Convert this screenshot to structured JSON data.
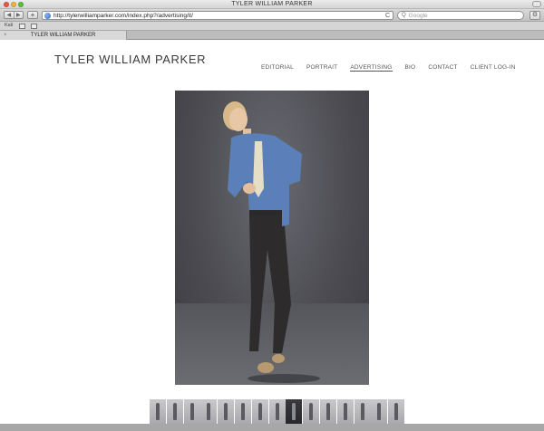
{
  "window": {
    "title": "TYLER WILLIAM PARKER"
  },
  "toolbar": {
    "back_icon": "back-arrow-icon",
    "forward_icon": "forward-arrow-icon",
    "back_glyph": "◀",
    "forward_glyph": "▶",
    "add_glyph": "+",
    "url": "http://tylerwilliamparker.com/index.php?/advertising/it/",
    "reload_glyph": "C",
    "search_placeholder": "Google",
    "search_glyph": "Q",
    "settings_glyph": "⚙"
  },
  "bookmarks": {
    "reader_label": "Kali"
  },
  "tabs": [
    {
      "label": "TYLER WILLIAM PARKER",
      "close_glyph": "×"
    }
  ],
  "site": {
    "title": "TYLER WILLIAM PARKER",
    "nav": [
      {
        "label": "EDITORIAL",
        "active": false
      },
      {
        "label": "PORTRAIT",
        "active": false
      },
      {
        "label": "ADVERTISING",
        "active": true
      },
      {
        "label": "BIO",
        "active": false
      },
      {
        "label": "CONTACT",
        "active": false
      },
      {
        "label": "CLIENT LOG-IN",
        "active": false
      }
    ]
  },
  "gallery": {
    "selected_index": 8,
    "thumbnail_count": 15
  }
}
